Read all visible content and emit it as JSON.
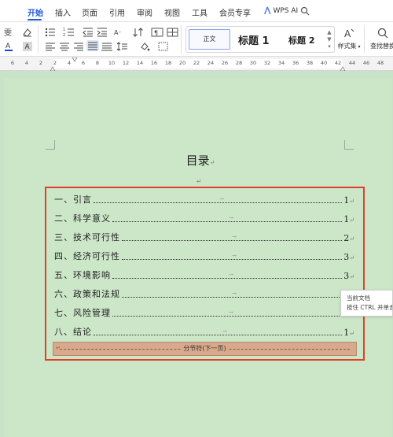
{
  "menu": {
    "items": [
      "开始",
      "插入",
      "页面",
      "引用",
      "审阅",
      "视图",
      "工具",
      "会员专享"
    ],
    "active": "开始",
    "wps_ai": "WPS AI"
  },
  "ribbon": {
    "styles": {
      "normal": "正文",
      "heading1": "标题 1",
      "heading2": "标题 2"
    },
    "style_set_label": "样式集",
    "find_label": "查找替换"
  },
  "ruler": {
    "ticks": [
      "6",
      "4",
      "2",
      "2",
      "4",
      "6",
      "8",
      "10",
      "12",
      "14",
      "16",
      "18",
      "20",
      "22",
      "24",
      "26",
      "28",
      "30",
      "32",
      "34",
      "36",
      "38",
      "40",
      "42",
      "44",
      "46",
      "48"
    ]
  },
  "document": {
    "title": "目录",
    "paragraph_mark": "↵",
    "arrow_mark": "→",
    "toc": [
      {
        "label": "一、引言",
        "page": "1"
      },
      {
        "label": "二、科学意义",
        "page": "1"
      },
      {
        "label": "三、技术可行性",
        "page": "2"
      },
      {
        "label": "四、经济可行性",
        "page": "3"
      },
      {
        "label": "五、环境影响",
        "page": "3"
      },
      {
        "label": "六、政策和法规",
        "page": ""
      },
      {
        "label": "七、风险管理",
        "page": ""
      },
      {
        "label": "八、结论",
        "page": "1"
      }
    ],
    "section_break": "分节符(下一页)"
  },
  "tooltip": {
    "line1": "当前文档",
    "line2": "按住 CTRL 并单击"
  },
  "colors": {
    "accent": "#1f5bd6",
    "page_background": "#cce6c8",
    "selection_border": "#e0402a",
    "section_break_fill": "#d9a98c"
  }
}
